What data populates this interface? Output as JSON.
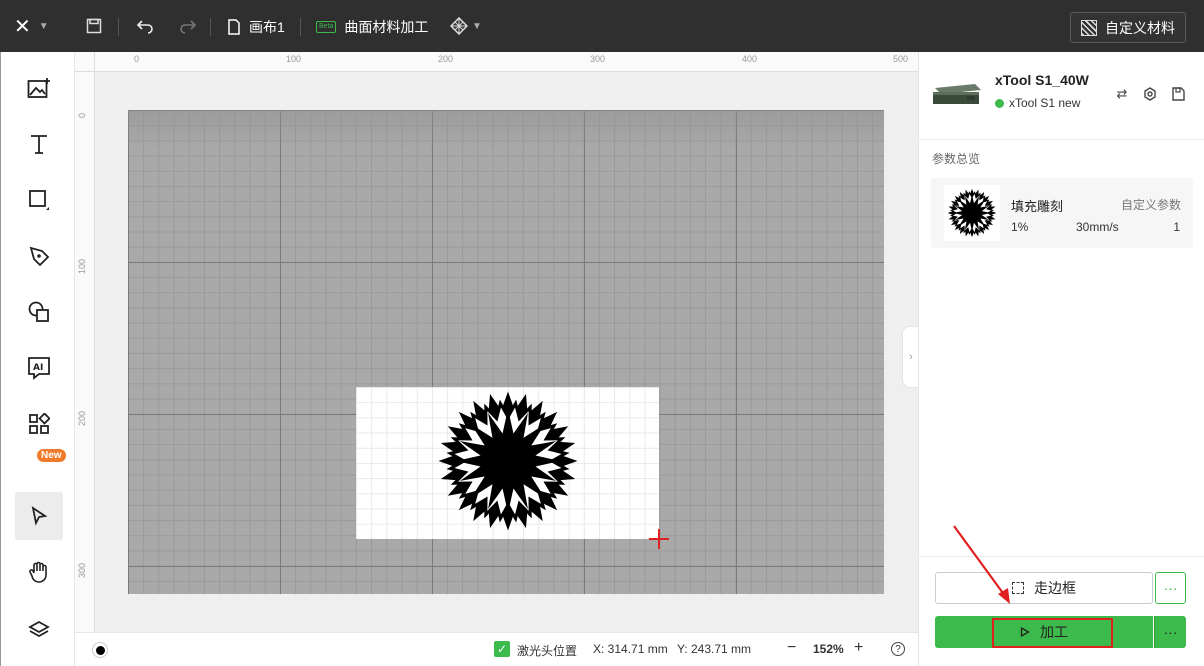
{
  "topbar": {
    "canvas_name": "画布1",
    "beta_label": "Beta",
    "curved_label": "曲面材料加工",
    "custom_material": "自定义材料"
  },
  "lefttools": {
    "new_badge": "New"
  },
  "rulers": {
    "top": [
      "0",
      "100",
      "200",
      "300",
      "400",
      "500"
    ],
    "left": [
      "0",
      "100",
      "200",
      "300"
    ]
  },
  "statusbar": {
    "laser_position_label": "激光头位置",
    "x": "X: 314.71 mm",
    "y": "Y: 243.71 mm",
    "zoom": "152%",
    "laser_position_checked": true
  },
  "device": {
    "model": "xTool S1_40W",
    "name": "xTool S1 new",
    "status_color": "#3cba4b"
  },
  "params": {
    "section_title": "参数总览",
    "item_name": "填充雕刻",
    "custom_label": "自定义参数",
    "power": "1%",
    "speed": "30mm/s",
    "passes": "1"
  },
  "actions": {
    "frame_label": "走边框",
    "process_label": "加工"
  },
  "colors": {
    "accent": "#3cba4b",
    "highlight": "#e02020",
    "badge": "#f07a2a"
  }
}
